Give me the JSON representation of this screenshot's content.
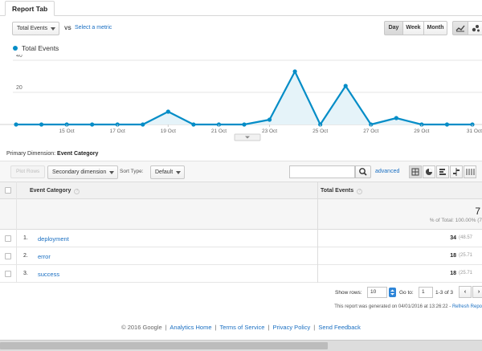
{
  "tab": {
    "label": "Report Tab"
  },
  "controls": {
    "metric_select": "Total Events",
    "vs": "VS",
    "select_metric": "Select a metric",
    "periods": [
      "Day",
      "Week",
      "Month"
    ],
    "active_period": "Day"
  },
  "chart_data": {
    "type": "line",
    "legend": "Total Events",
    "color": "#058dc7",
    "y_ticks": [
      "40",
      "20"
    ],
    "ylim": [
      0,
      40
    ],
    "x_tick_labels": [
      "15 Oct",
      "17 Oct",
      "19 Oct",
      "21 Oct",
      "23 Oct",
      "25 Oct",
      "27 Oct",
      "29 Oct",
      "31 Oct"
    ],
    "points": [
      {
        "date": "2016-10-13",
        "value": 0
      },
      {
        "date": "2016-10-14",
        "value": 0
      },
      {
        "date": "2016-10-15",
        "value": 0
      },
      {
        "date": "2016-10-16",
        "value": 0
      },
      {
        "date": "2016-10-17",
        "value": 0
      },
      {
        "date": "2016-10-18",
        "value": 0
      },
      {
        "date": "2016-10-19",
        "value": 8
      },
      {
        "date": "2016-10-20",
        "value": 0
      },
      {
        "date": "2016-10-21",
        "value": 0
      },
      {
        "date": "2016-10-22",
        "value": 0
      },
      {
        "date": "2016-10-23",
        "value": 3
      },
      {
        "date": "2016-10-24",
        "value": 33
      },
      {
        "date": "2016-10-25",
        "value": 0
      },
      {
        "date": "2016-10-26",
        "value": 24
      },
      {
        "date": "2016-10-27",
        "value": 0
      },
      {
        "date": "2016-10-28",
        "value": 4
      },
      {
        "date": "2016-10-29",
        "value": 0
      },
      {
        "date": "2016-10-30",
        "value": 0
      },
      {
        "date": "2016-10-31",
        "value": 0
      }
    ],
    "grid": true
  },
  "dimension": {
    "label": "Primary Dimension:",
    "value": "Event Category"
  },
  "toolbar": {
    "plot_rows": "Plot Rows",
    "secondary_dimension": "Secondary dimension",
    "sort_type_label": "Sort Type:",
    "sort_type_value": "Default",
    "search_placeholder": "",
    "advanced": "advanced"
  },
  "table": {
    "col_category": "Event Category",
    "col_events": "Total Events",
    "total_value": "7",
    "total_pct": "% of Total: 100.00% (7",
    "rows": [
      {
        "idx": "1.",
        "name": "deployment",
        "value": "34",
        "pct": "(48.57"
      },
      {
        "idx": "2.",
        "name": "error",
        "value": "18",
        "pct": "(25.71"
      },
      {
        "idx": "3.",
        "name": "success",
        "value": "18",
        "pct": "(25.71"
      }
    ]
  },
  "pager": {
    "show_rows_label": "Show rows:",
    "show_rows_value": "10",
    "goto_label": "Go to:",
    "goto_value": "1",
    "range": "1-3 of 3"
  },
  "generated": {
    "text": "This report was generated on 04/01/2016 at 13:26:22 - ",
    "refresh": "Refresh Repo"
  },
  "footer": {
    "copyright": "© 2016 Google",
    "links": [
      "Analytics Home",
      "Terms of Service",
      "Privacy Policy",
      "Send Feedback"
    ]
  }
}
